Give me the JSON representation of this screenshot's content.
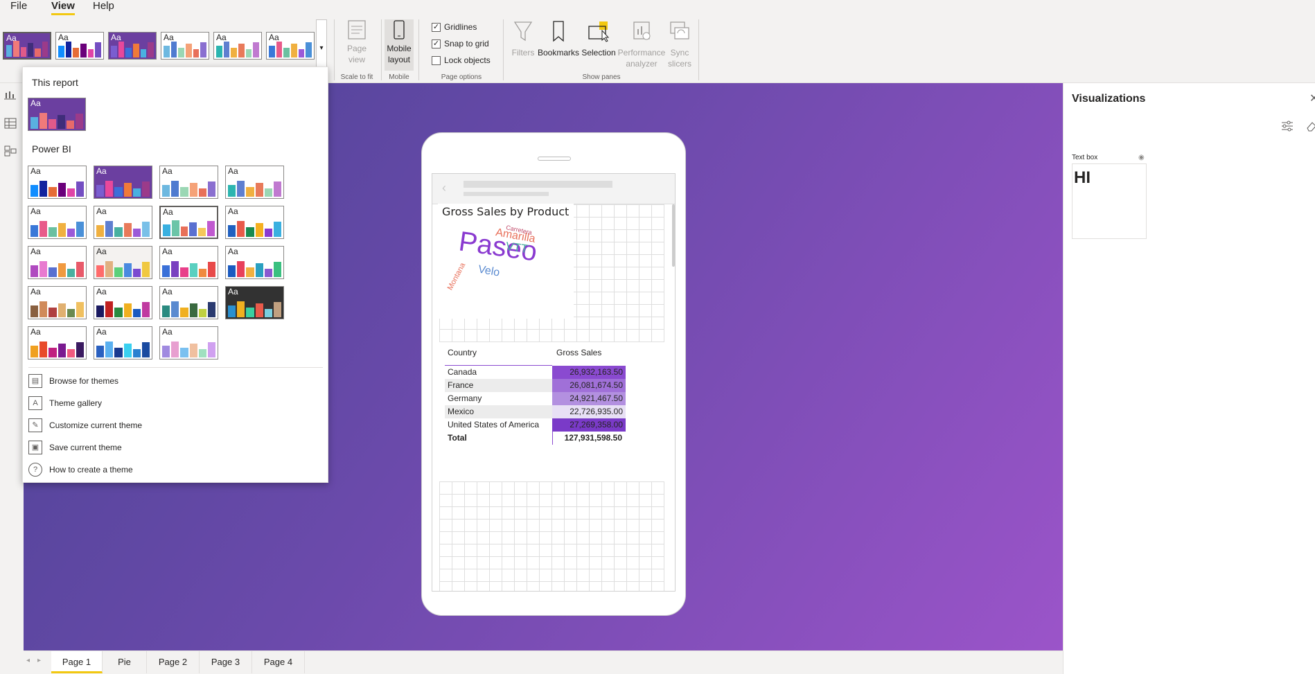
{
  "menu": {
    "file": "File",
    "view": "View",
    "help": "Help"
  },
  "ribbon": {
    "page_view": "Page view",
    "mobile_layout": "Mobile layout",
    "scale_to_fit": "Scale to fit",
    "mobile": "Mobile",
    "gridlines": "Gridlines",
    "snap_to_grid": "Snap to grid",
    "lock_objects": "Lock objects",
    "page_options": "Page options",
    "filters": "Filters",
    "bookmarks": "Bookmarks",
    "selection": "Selection",
    "performance_analyzer": "Performance analyzer",
    "sync_slicers": "Sync slicers",
    "show_panes": "Show panes",
    "gridlines_checked": true,
    "snap_checked": true,
    "lock_checked": false
  },
  "theme_menu": {
    "this_report": "This report",
    "power_bi": "Power BI",
    "theme_label": "Aa",
    "links": [
      {
        "label": "Browse for themes",
        "icon": "browse-icon"
      },
      {
        "label": "Theme gallery",
        "icon": "gallery-icon"
      },
      {
        "label": "Customize current theme",
        "icon": "customize-icon"
      },
      {
        "label": "Save current theme",
        "icon": "save-icon"
      },
      {
        "label": "How to create a theme",
        "icon": "help-circle-icon"
      }
    ]
  },
  "themes": [
    {
      "bg": "#6b3fa0",
      "fg": "#fff",
      "c": [
        "#5ab0e0",
        "#f07a7a",
        "#e05a8a",
        "#3f2d7a",
        "#e86a6a",
        "#9b3b8a"
      ]
    },
    {
      "bg": "#ffffff",
      "fg": "#252423",
      "c": [
        "#118dff",
        "#12239e",
        "#e66c37",
        "#6b007b",
        "#e044a7",
        "#744ec2"
      ]
    },
    {
      "bg": "#6b3fa0",
      "fg": "#fff",
      "c": [
        "#7a5ed0",
        "#e8489b",
        "#3d6fd8",
        "#f07a3a",
        "#4ab0e0",
        "#9b3b8a"
      ]
    },
    {
      "bg": "#ffffff",
      "fg": "#252423",
      "c": [
        "#6db8e0",
        "#4f7bd0",
        "#9bd7b4",
        "#f5a278",
        "#e8705a",
        "#8a6fd0"
      ]
    },
    {
      "bg": "#ffffff",
      "fg": "#252423",
      "c": [
        "#2cb5b0",
        "#5f7fd0",
        "#f0b040",
        "#e87a5a",
        "#9bd7b4",
        "#c07ad0"
      ]
    },
    {
      "bg": "#ffffff",
      "fg": "#252423",
      "c": [
        "#3a78d8",
        "#e85a8a",
        "#6bc0a0",
        "#f0b040",
        "#9a5ad8",
        "#4a90d8"
      ]
    },
    {
      "bg": "#ffffff",
      "fg": "#252423",
      "c": [
        "#f0b040",
        "#5f7fd0",
        "#48b0a0",
        "#e87a5a",
        "#9b5ad8",
        "#7ac0e8"
      ]
    },
    {
      "bg": "#ffffff",
      "fg": "#252423",
      "c": [
        "#3ab0e0",
        "#6bc5a8",
        "#e8705a",
        "#5a70d0",
        "#f5c85a",
        "#c05ad0"
      ]
    },
    {
      "bg": "#ffffff",
      "fg": "#252423",
      "c": [
        "#2060c0",
        "#e85a4a",
        "#1a8a50",
        "#f5b020",
        "#8a3ad0",
        "#3ab0e0"
      ]
    },
    {
      "bg": "#ffffff",
      "fg": "#252423",
      "c": [
        "#b04ac0",
        "#e87ad0",
        "#5a70d0",
        "#f09a40",
        "#4ab0a0",
        "#e85a6a"
      ]
    },
    {
      "bg": "#f4f2f0",
      "fg": "#252423",
      "c": [
        "#ff6b6b",
        "#e0b080",
        "#5ad07a",
        "#4a8ae0",
        "#7a4ad0",
        "#f0c840"
      ]
    },
    {
      "bg": "#ffffff",
      "fg": "#252423",
      "c": [
        "#3a70d8",
        "#7a40c0",
        "#e8408a",
        "#5ad0c0",
        "#f08a40",
        "#e84a4a"
      ]
    },
    {
      "bg": "#ffffff",
      "fg": "#252423",
      "c": [
        "#1a5ac0",
        "#e8405a",
        "#f0b040",
        "#2aa0c0",
        "#8a5ad0",
        "#3ac080"
      ]
    },
    {
      "bg": "#ffffff",
      "fg": "#252423",
      "c": [
        "#8a6040",
        "#d08a5a",
        "#b04040",
        "#e0b070",
        "#6a8a50",
        "#f0c060"
      ]
    },
    {
      "bg": "#ffffff",
      "fg": "#252423",
      "c": [
        "#1a1a60",
        "#c02020",
        "#2a8a40",
        "#f0b020",
        "#1a5ac0",
        "#c03aa0"
      ]
    },
    {
      "bg": "#ffffff",
      "fg": "#252423",
      "c": [
        "#2a8a80",
        "#5a8ad0",
        "#f0b020",
        "#3a6a40",
        "#c0d040",
        "#2a3a70"
      ]
    },
    {
      "bg": "#323232",
      "fg": "#fff",
      "c": [
        "#2a90d0",
        "#f0b020",
        "#3ad0a0",
        "#e85a4a",
        "#7ad0e0",
        "#c0a080"
      ]
    },
    {
      "bg": "#ffffff",
      "fg": "#252423",
      "c": [
        "#f0a020",
        "#e84a2a",
        "#c02080",
        "#7a1a90",
        "#f05a80",
        "#3a1a60"
      ]
    },
    {
      "bg": "#ffffff",
      "fg": "#252423",
      "c": [
        "#2a60c0",
        "#5ab0f0",
        "#1a3a90",
        "#3ad0f0",
        "#2a80d0",
        "#1a4aa0"
      ]
    },
    {
      "bg": "#ffffff",
      "fg": "#252423",
      "c": [
        "#a08ae0",
        "#e8a0d0",
        "#7ac0f0",
        "#f0c0a0",
        "#a0e0c0",
        "#d0a0f0"
      ]
    },
    {
      "bg": "#ffffff",
      "fg": "#252423",
      "c": [
        "#1a2a70",
        "#4a8ae0",
        "#2ab0e0",
        "#c02a3a",
        "#7a8ad0",
        "#9a2a2a"
      ]
    },
    {
      "bg": "#0c2a6a",
      "fg": "#fff",
      "c": [
        "#1a5ad0",
        "#2a90e0",
        "#3ab040",
        "#1a70c0",
        "#60c050",
        "#2a60a0"
      ]
    },
    {
      "bg": "#ffffff",
      "fg": "#252423",
      "c": [
        "#e87a3a",
        "#1a5a90",
        "#f0b040",
        "#2a9a8a",
        "#e85a3a",
        "#3a6ab0"
      ]
    }
  ],
  "canvas_visual": {
    "title": "Gross Sales by Product",
    "words": [
      {
        "text": "Paseo",
        "color": "#8a3ad0"
      },
      {
        "text": "Amarilla",
        "color": "#e8705a"
      },
      {
        "text": "VTT",
        "color": "#4ab0a0"
      },
      {
        "text": "Velo",
        "color": "#5a8ad0"
      },
      {
        "text": "Montana",
        "color": "#e8705a"
      },
      {
        "text": "Carretera",
        "color": "#c04a6a"
      }
    ]
  },
  "table": {
    "col_country": "Country",
    "col_sales": "Gross Sales",
    "rows": [
      {
        "country": "Canada",
        "sales": "26,932,163.50",
        "shade": "#8a4ad0"
      },
      {
        "country": "France",
        "sales": "26,081,674.50",
        "shade": "#a070d8"
      },
      {
        "country": "Germany",
        "sales": "24,921,467.50",
        "shade": "#b390e0"
      },
      {
        "country": "Mexico",
        "sales": "22,726,935.00",
        "shade": "#e8e0f5"
      },
      {
        "country": "United States of America",
        "sales": "27,269,358.00",
        "shade": "#7a3ac8"
      }
    ],
    "total_label": "Total",
    "total_value": "127,931,598.50"
  },
  "viz_pane": {
    "title": "Visualizations",
    "text_box_label": "Text box",
    "text_box_value": "HI"
  },
  "page_tabs": [
    "Page 1",
    "Pie",
    "Page 2",
    "Page 3",
    "Page 4"
  ]
}
